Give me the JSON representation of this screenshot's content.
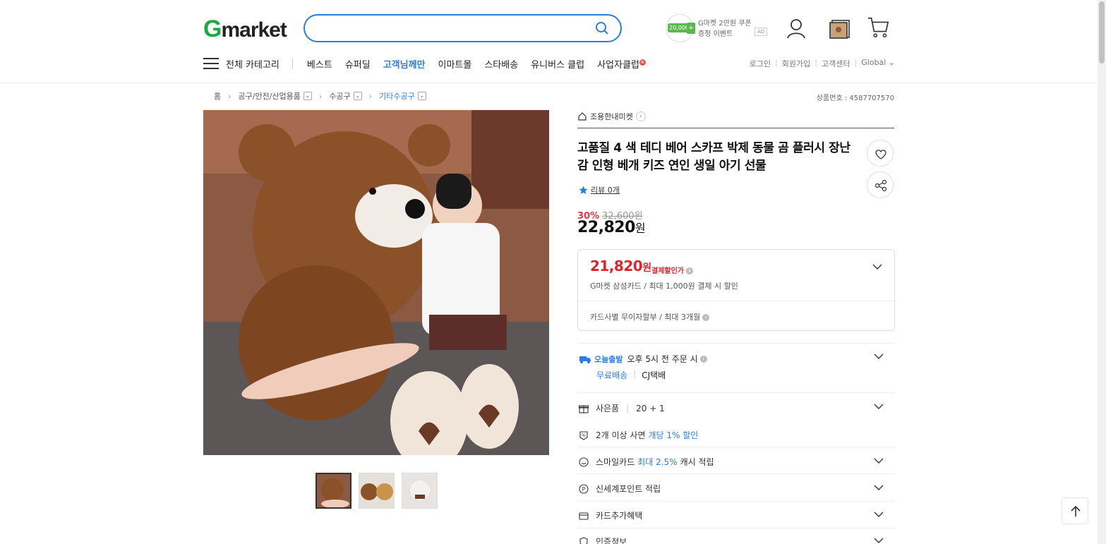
{
  "header": {
    "logo_g": "G",
    "logo_rest": "market",
    "search_value": "",
    "promo": {
      "coin": "20,000",
      "line1": "G마켓 2만원 쿠폰",
      "line2": "증정 이벤트",
      "ad": "AD"
    }
  },
  "nav": {
    "all_categories": "전체 카테고리",
    "items": [
      "베스트",
      "슈퍼딜",
      "고객님께만",
      "이마트몰",
      "스타배송",
      "유니버스 클럽",
      "사업자클럽"
    ],
    "badge": "N",
    "util": [
      "로그인",
      "회원가입",
      "고객센터",
      "Global"
    ]
  },
  "breadcrumb": {
    "home": "홈",
    "items": [
      "공구/안전/산업용품",
      "수공구",
      "기타수공구"
    ]
  },
  "product_no": "상품번호 : 4587707570",
  "shop": "조용한내미켓",
  "title": "고품질 4 색 테디 베어 스카프 박제 동물 곰 플러시 장난감 인형 베개 키즈 연인 생일 아기 선물",
  "review": "리뷰 0개",
  "discount": {
    "pct": "30%",
    "original": "32,600원"
  },
  "price": {
    "amount": "22,820",
    "unit": "원"
  },
  "card_box": {
    "price": "21,820",
    "unit": "원",
    "label": "결제할인가",
    "desc": "G마켓 삼성카드 / 최대 1,000원 결제 시 할인",
    "installment": "카드사별 무이자할부 / 최대 3개월"
  },
  "shipping": {
    "today": "오늘출발",
    "cutoff": "오후 5시 전 주문 시",
    "free": "무료배송",
    "carrier": "CJ택배"
  },
  "benefits": {
    "gift_label": "사은품",
    "gift_value": "20 + 1",
    "multi_pre": "2개 이상 사면",
    "multi_hl": "개당 1% 할인",
    "smile_pre": "스마일카드",
    "smile_hl": "최대 2.5%",
    "smile_post": "캐시 적립",
    "point": "신세계포인트 적립",
    "card_extra": "카드추가혜택",
    "cert": "인증정보"
  },
  "colors": {
    "accent": "#2a7de1",
    "sale": "#e4212c",
    "logo_green": "#1aab3f"
  }
}
